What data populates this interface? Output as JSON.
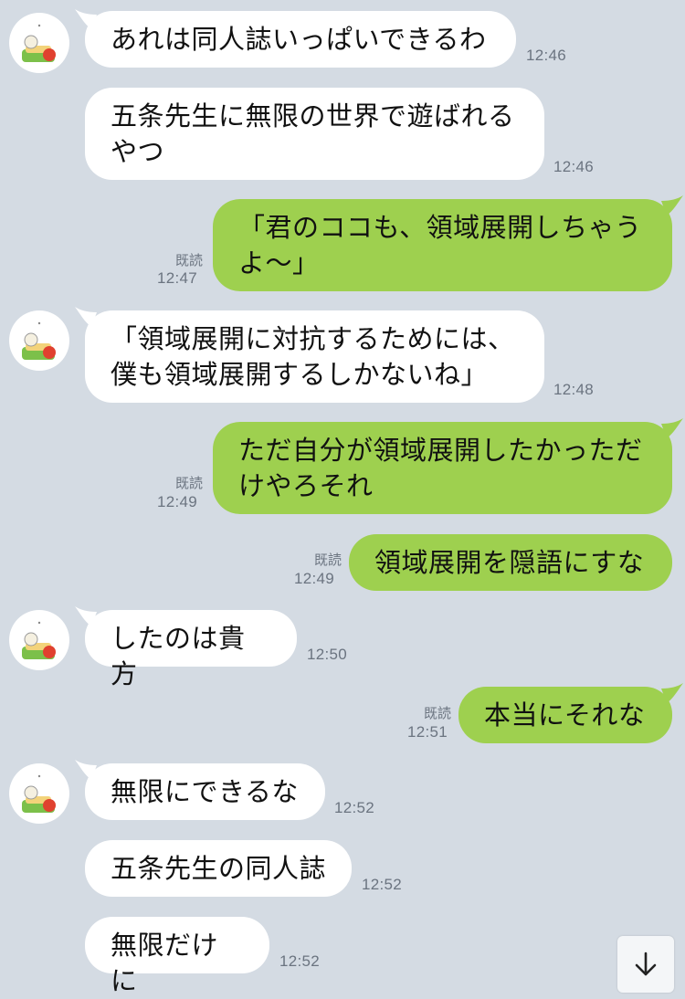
{
  "messages": [
    {
      "dir": "in",
      "text": "あれは同人誌いっぱいできるわ",
      "time": "12:46"
    },
    {
      "dir": "in",
      "text": "五条先生に無限の世界で遊ばれる\nやつ",
      "time": "12:46"
    },
    {
      "dir": "out",
      "text": "「君のココも、領域展開しちゃう\nよ〜」",
      "time": "12:47",
      "read": "既読"
    },
    {
      "dir": "in",
      "text": "「領域展開に対抗するためには、\n僕も領域展開するしかないね」",
      "time": "12:48"
    },
    {
      "dir": "out",
      "text": "ただ自分が領域展開したかっただ\nけやろそれ",
      "time": "12:49",
      "read": "既読"
    },
    {
      "dir": "out",
      "text": "領域展開を隠語にすな",
      "time": "12:49",
      "read": "既読"
    },
    {
      "dir": "in",
      "text": "したのは貴方",
      "time": "12:50"
    },
    {
      "dir": "out",
      "text": "本当にそれな",
      "time": "12:51",
      "read": "既読"
    },
    {
      "dir": "in",
      "text": "無限にできるな",
      "time": "12:52"
    },
    {
      "dir": "in",
      "text": "五条先生の同人誌",
      "time": "12:52"
    },
    {
      "dir": "in",
      "text": "無限だけに",
      "time": "12:52"
    }
  ],
  "scroll_button": {
    "icon": "arrow-down-icon"
  },
  "colors": {
    "background": "#d4dbe3",
    "incoming": "#ffffff",
    "outgoing": "#9ed04f"
  }
}
